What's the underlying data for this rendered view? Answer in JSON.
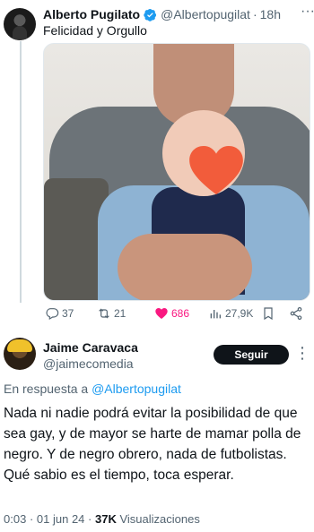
{
  "original_tweet": {
    "author_name": "Alberto Pugilato",
    "handle": "@Albertopugilat",
    "separator": "·",
    "time": "18h",
    "text": "Felicidad y Orgullo",
    "more": "···",
    "actions": {
      "replies": "37",
      "retweets": "21",
      "likes": "686",
      "views": "27,9K"
    },
    "like_color": "#f91880",
    "verified_color": "#1d9bf0"
  },
  "reply_tweet": {
    "author_name": "Jaime Caravaca",
    "handle": "@jaimecomedia",
    "follow_label": "Seguir",
    "more": "⋮",
    "reply_prefix": "En respuesta a",
    "reply_mention": "@Albertopugilat",
    "text": "Nada ni nadie podrá evitar la posibilidad de que sea gay, y de mayor se harte de mamar polla de negro. Y de negro obrero, nada de futbolistas. Qué sabio es el tiempo, toca esperar.",
    "time": "0:03",
    "date_sep": "·",
    "date": "01 jun 24",
    "views_sep": "·",
    "views_count": "37K",
    "views_label": "Visualizaciones",
    "mention_color": "#1d9bf0"
  }
}
